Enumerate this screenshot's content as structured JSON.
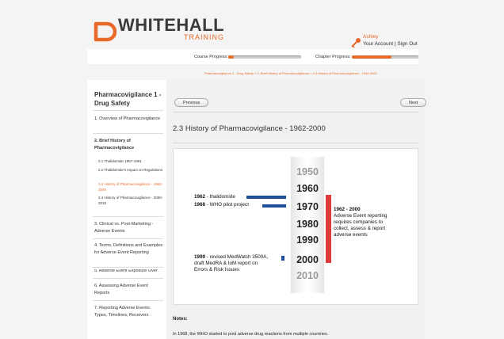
{
  "brand": {
    "name": "WHITEHALL",
    "tagline": "TRAINING",
    "accent": "#e86a2a"
  },
  "account": {
    "user_name": "Ashley",
    "your_account": "Your Account",
    "separator": "|",
    "sign_out": "Sign Out",
    "icon": "key-icon"
  },
  "progress": {
    "course_label": "Course Progress:",
    "course_fraction": 0.08,
    "chapter_label": "Chapter Progress:",
    "chapter_fraction": 0.6
  },
  "breadcrumb": "Pharmacovigilance 1 - Drug Safety > 2. Brief History of Pharmacovigilance > 2.3 History of Pharmacovigilance - 1962-2000",
  "sidebar": {
    "title": "Pharmacovigilance 1 - Drug Safety",
    "items": [
      {
        "label": "1. Overview of Pharmacovigilance",
        "bold": false
      },
      {
        "label": "2. Brief History of Pharmacovigilance",
        "bold": true
      },
      {
        "label": "3. Clinical vs. Post-Marketing - Adverse Events",
        "bold": false
      },
      {
        "label": "4. Terms, Definitions and Examples for Adverse Event Reporting",
        "bold": false
      },
      {
        "label": "5. Adverse Event Exposure Over",
        "bold": false
      },
      {
        "label": "6. Assessing Adverse Event Reports",
        "bold": false
      },
      {
        "label": "7. Reporting Adverse Events: Types, Timelines, Receivers",
        "bold": false
      }
    ],
    "subitems": [
      {
        "label": "2.1 Thalidomide 1957-1961",
        "active": false
      },
      {
        "label": "2.2 Thalidomide's Impact on Regulations",
        "active": false
      },
      {
        "label": "2.3 History of Pharmacovigilance - 1962-2000",
        "active": true
      },
      {
        "label": "2.4 History of Pharmacovigilance - 2000-2010",
        "active": false
      }
    ]
  },
  "main": {
    "previous_label": "Previous",
    "next_label": "Next",
    "title": "2.3 History of Pharmacovigilance - 1962-2000",
    "timeline": {
      "years": [
        "1950",
        "1960",
        "1970",
        "1980",
        "1990",
        "2000",
        "2010"
      ],
      "events": [
        {
          "year": "1962",
          "text": " - thalidomide"
        },
        {
          "year": "1968",
          "text": " - WHO pilot project"
        },
        {
          "year": "1999",
          "line1": " - revised MedWatch 3500A,",
          "line2": "draft MedRA & IoM report on",
          "line3": "Errors & Risk Issues"
        }
      ],
      "range_event": {
        "heading": "1962 - 2000",
        "lines": [
          "Adverse Event reporting",
          "requires companies to",
          "collect, assess & report",
          "adverse events"
        ]
      },
      "colors": {
        "event_bar": "#1f4e9c",
        "range_bar": "#e03b3b"
      }
    },
    "notes_label": "Notes:",
    "notes_text": "In 1968, the WHO started to pool adverse drug reactions from multiple countries."
  }
}
